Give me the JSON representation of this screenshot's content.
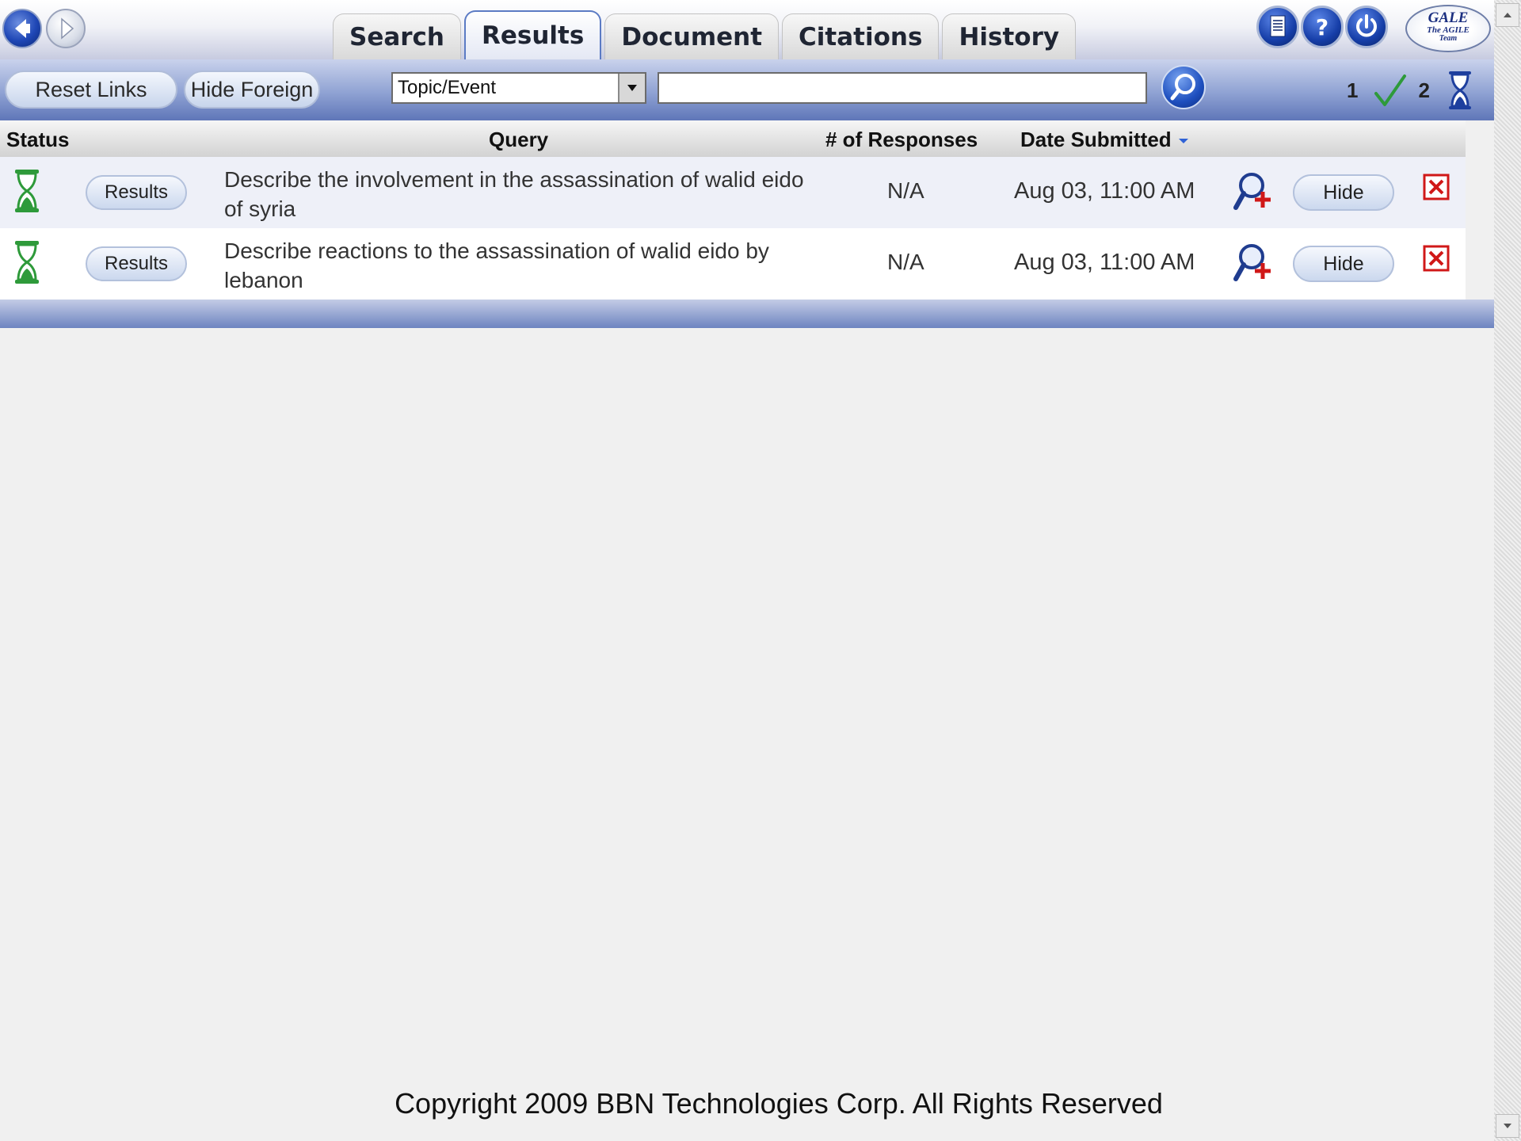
{
  "nav": {
    "back_icon": "back-arrow-icon",
    "forward_icon": "forward-arrow-icon"
  },
  "tabs": [
    {
      "label": "Search",
      "active": false
    },
    {
      "label": "Results",
      "active": true
    },
    {
      "label": "Document",
      "active": false
    },
    {
      "label": "Citations",
      "active": false
    },
    {
      "label": "History",
      "active": false
    }
  ],
  "header_icons": [
    "document-icon",
    "help-icon",
    "power-icon"
  ],
  "logo": {
    "line1": "GALE",
    "line2": "The AGILE",
    "line3": "Team"
  },
  "toolbar": {
    "reset_links_label": "Reset Links",
    "hide_foreign_label": "Hide Foreign",
    "query_type_selected": "Topic/Event",
    "search_value": "",
    "completed_count": "1",
    "pending_count": "2"
  },
  "table": {
    "headers": {
      "status": "Status",
      "query": "Query",
      "responses": "# of Responses",
      "date": "Date Submitted"
    },
    "rows": [
      {
        "status_icon": "hourglass-icon",
        "results_label": "Results",
        "query": "Describe the involvement in the assassination of walid eido of syria",
        "responses": "N/A",
        "date": "Aug 03, 11:00 AM",
        "hide_label": "Hide"
      },
      {
        "status_icon": "hourglass-icon",
        "results_label": "Results",
        "query": "Describe reactions to the assassination of walid eido by lebanon",
        "responses": "N/A",
        "date": "Aug 03, 11:00 AM",
        "hide_label": "Hide"
      }
    ]
  },
  "footer": {
    "copyright": "Copyright 2009 BBN Technologies Corp. All Rights Reserved"
  },
  "colors": {
    "accent": "#1f47b6",
    "status_green": "#2e9a3a",
    "delete_red": "#d01818"
  }
}
